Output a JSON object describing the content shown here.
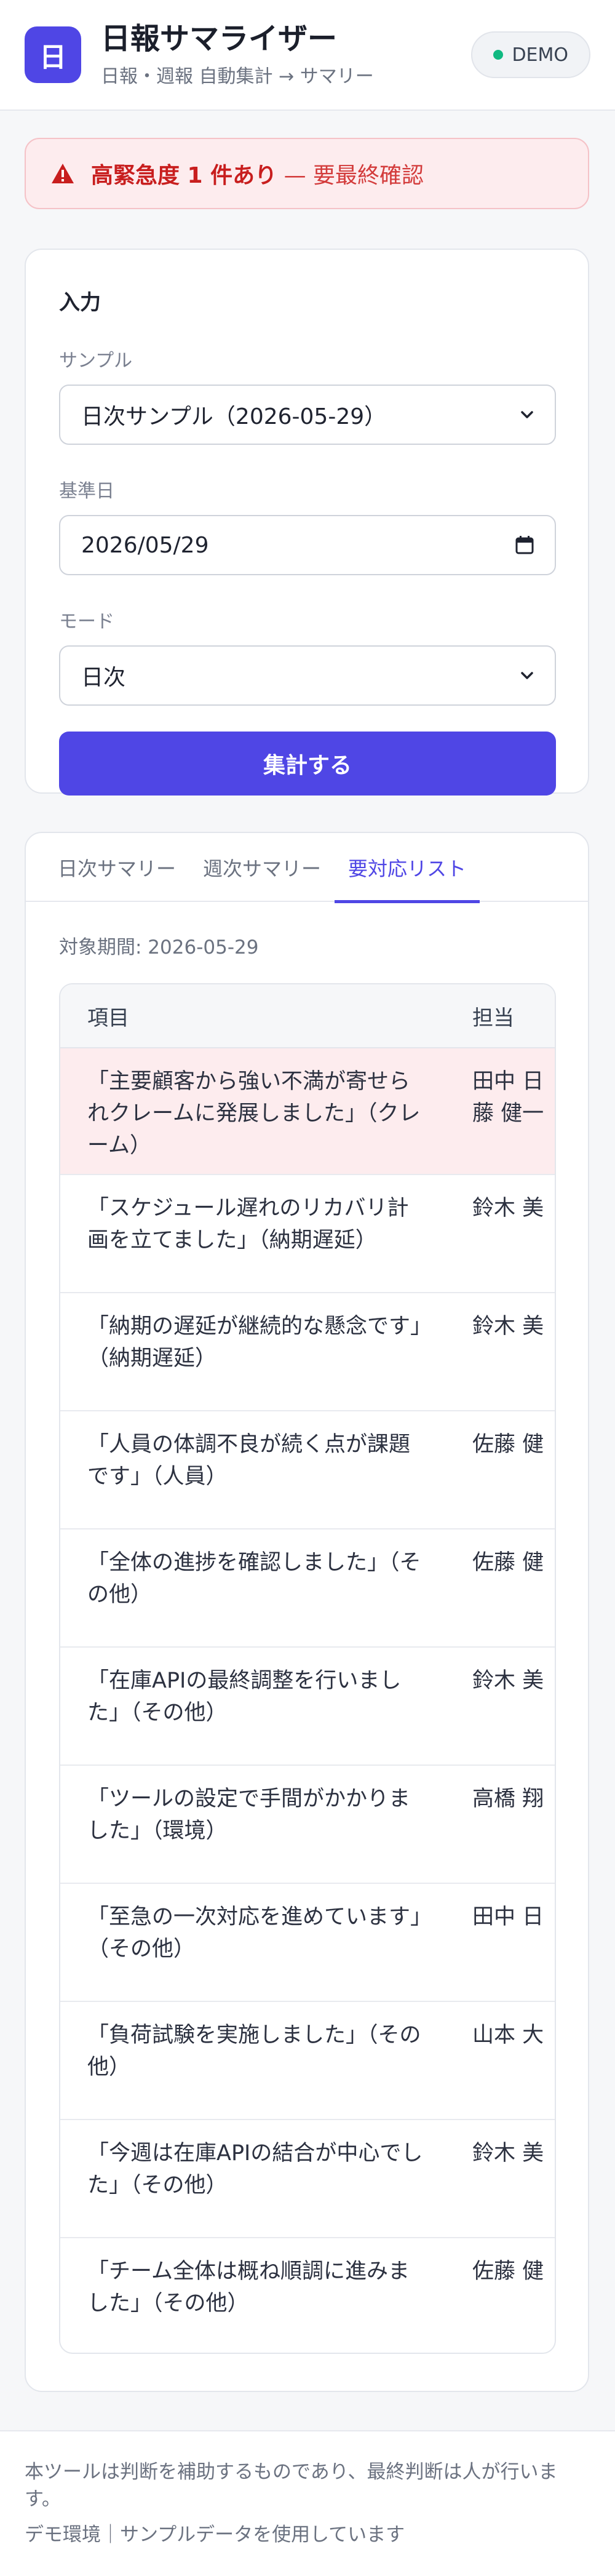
{
  "header": {
    "logo_char": "日",
    "title": "日報サマライザー",
    "subtitle": "日報・週報 自動集計 → サマリー",
    "badge": "DEMO"
  },
  "alert": {
    "strong": "高緊急度 1 件あり",
    "rest": " — 要最終確認"
  },
  "input": {
    "section_title": "入力",
    "sample_label": "サンプル",
    "sample_value": "日次サンプル（2026-05-29）",
    "date_label": "基準日",
    "date_value": "2026/05/29",
    "mode_label": "モード",
    "mode_value": "日次",
    "submit_label": "集計する"
  },
  "result": {
    "tabs": [
      {
        "label": "日次サマリー"
      },
      {
        "label": "週次サマリー"
      },
      {
        "label": "要対応リスト"
      }
    ],
    "active_tab": 2,
    "period": "対象期間: 2026-05-29",
    "table": {
      "headers": [
        "項目",
        "担当"
      ],
      "rows": [
        {
          "item": "「主要顧客から強い不満が寄せられクレームに発展しました」（クレーム）",
          "owner": "田中 日",
          "owner2": "藤 健一",
          "urgent": true
        },
        {
          "item": "「スケジュール遅れのリカバリ計画を立てました」（納期遅延）",
          "owner": "鈴木 美"
        },
        {
          "item": "「納期の遅延が継続的な懸念です」（納期遅延）",
          "owner": "鈴木 美"
        },
        {
          "item": "「人員の体調不良が続く点が課題です」（人員）",
          "owner": "佐藤 健"
        },
        {
          "item": "「全体の進捗を確認しました」（その他）",
          "owner": "佐藤 健"
        },
        {
          "item": "「在庫APIの最終調整を行いました」（その他）",
          "owner": "鈴木 美"
        },
        {
          "item": "「ツールの設定で手間がかかりました」（環境）",
          "owner": "高橋 翔"
        },
        {
          "item": "「至急の一次対応を進めています」（その他）",
          "owner": "田中 日"
        },
        {
          "item": "「負荷試験を実施しました」（その他）",
          "owner": "山本 大"
        },
        {
          "item": "「今週は在庫APIの結合が中心でした」（その他）",
          "owner": "鈴木 美"
        },
        {
          "item": "「チーム全体は概ね順調に進みました」（その他）",
          "owner": "佐藤 健"
        }
      ]
    }
  },
  "footer": {
    "line1": "本ツールは判断を補助するものであり、最終判断は人が行います。",
    "line2": "デモ環境｜サンプルデータを使用しています"
  },
  "colors": {
    "accent": "#4f46e5",
    "alert_bg": "#fdecee",
    "alert_text": "#c81e1e",
    "status_dot": "#10b981"
  }
}
